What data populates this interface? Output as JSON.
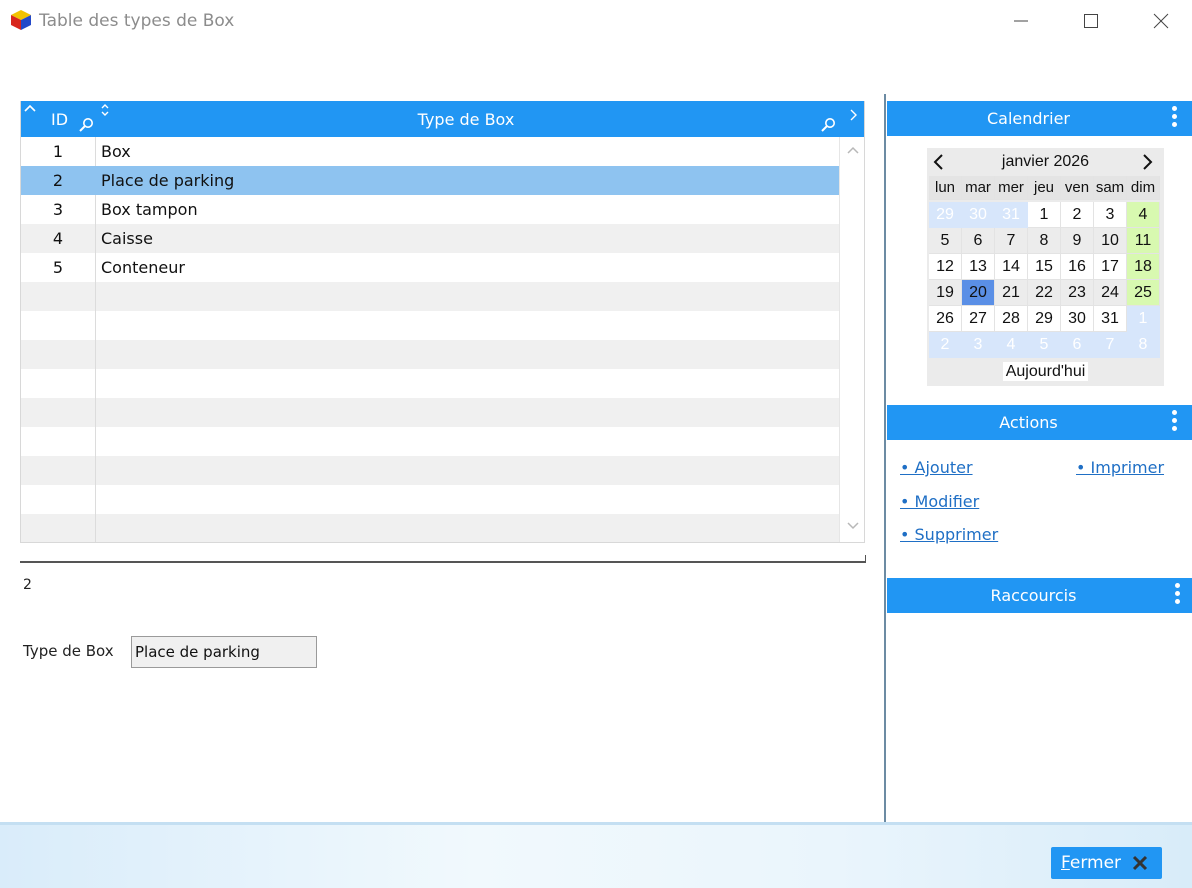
{
  "window": {
    "title": "Table des types de Box"
  },
  "grid": {
    "columns": [
      {
        "label": "ID"
      },
      {
        "label": "Type de Box"
      }
    ],
    "rows": [
      {
        "id": "1",
        "type": "Box"
      },
      {
        "id": "2",
        "type": "Place de parking"
      },
      {
        "id": "3",
        "type": "Box tampon"
      },
      {
        "id": "4",
        "type": "Caisse"
      },
      {
        "id": "5",
        "type": "Conteneur"
      }
    ],
    "selected_row": 2
  },
  "record": {
    "id": "2",
    "field_label": "Type de Box",
    "field_value": "Place de parking"
  },
  "calendar": {
    "title": "Calendrier",
    "month": "janvier 2026",
    "weekdays": [
      "lun",
      "mar",
      "mer",
      "jeu",
      "ven",
      "sam",
      "dim"
    ],
    "weeks": [
      [
        "29",
        "30",
        "31",
        "1",
        "2",
        "3",
        "4"
      ],
      [
        "5",
        "6",
        "7",
        "8",
        "9",
        "10",
        "11"
      ],
      [
        "12",
        "13",
        "14",
        "15",
        "16",
        "17",
        "18"
      ],
      [
        "19",
        "20",
        "21",
        "22",
        "23",
        "24",
        "25"
      ],
      [
        "26",
        "27",
        "28",
        "29",
        "30",
        "31",
        "1"
      ],
      [
        "2",
        "3",
        "4",
        "5",
        "6",
        "7",
        "8"
      ]
    ],
    "today_label": "Aujourd'hui",
    "selected_day": "20",
    "colors": {
      "weekend": "#d8f9b0",
      "selected": "#5a8fe6",
      "other_month": "#d7e6fb"
    }
  },
  "actions": {
    "title": "Actions",
    "add": "• Ajouter",
    "print": "• Imprimer",
    "edit": "• Modifier",
    "delete": "• Supprimer"
  },
  "shortcuts": {
    "title": "Raccourcis"
  },
  "footer": {
    "close_first": "F",
    "close_rest": "ermer"
  },
  "theme": {
    "accent": "#2196f3",
    "selection": "#8ec3f0",
    "link": "#1f6fc5"
  }
}
